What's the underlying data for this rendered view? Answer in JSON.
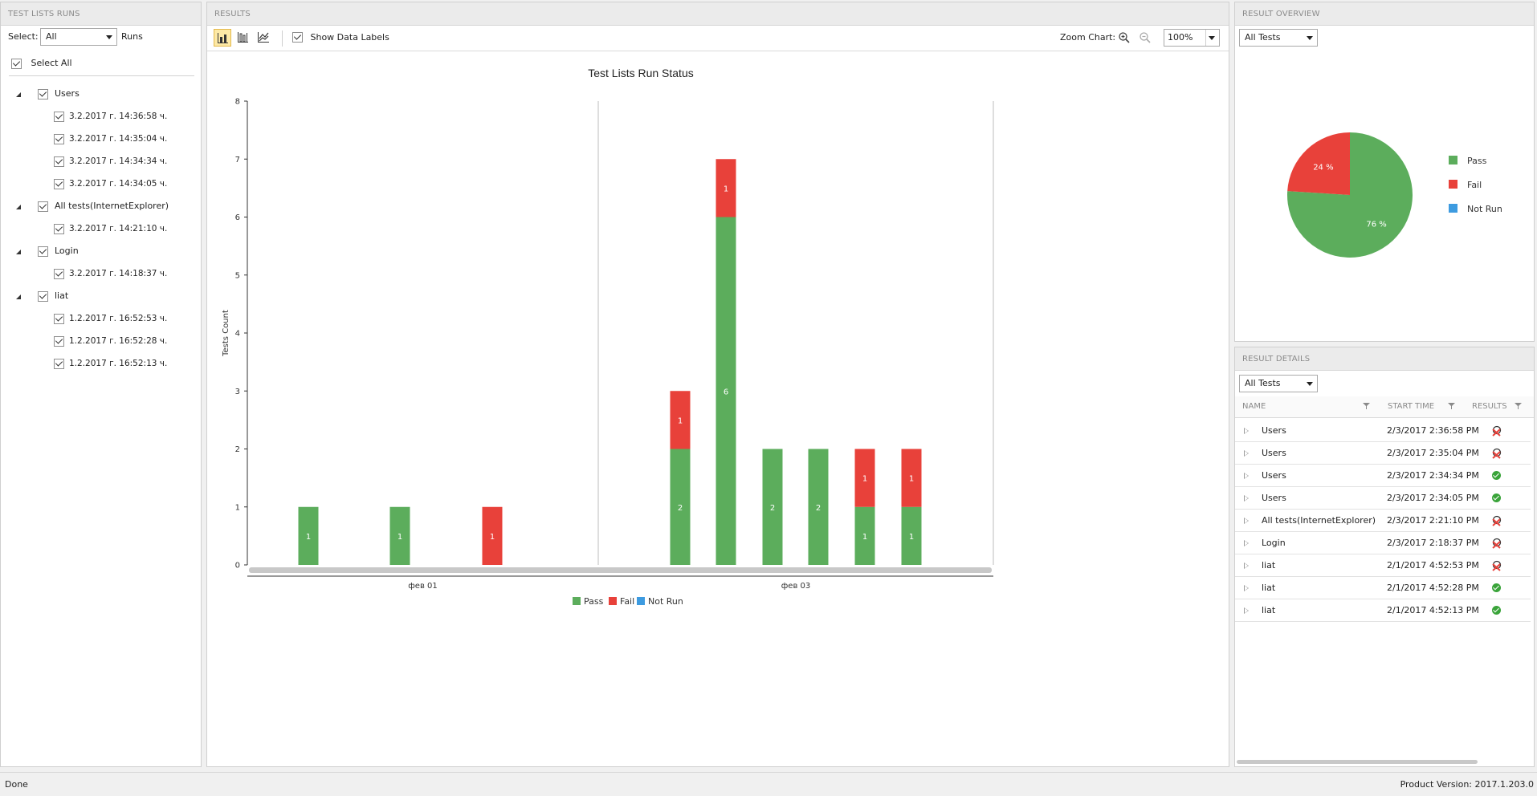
{
  "test_lists_runs": {
    "header": "TEST LISTS RUNS",
    "select_label": "Select:",
    "select_value": "All",
    "runs_label": "Runs",
    "select_all_label": "Select All",
    "groups": [
      {
        "name": "Users",
        "runs": [
          "3.2.2017 г. 14:36:58 ч.",
          "3.2.2017 г. 14:35:04 ч.",
          "3.2.2017 г. 14:34:34 ч.",
          "3.2.2017 г. 14:34:05 ч."
        ]
      },
      {
        "name": "All tests(InternetExplorer)",
        "runs": [
          "3.2.2017 г. 14:21:10 ч."
        ]
      },
      {
        "name": "Login",
        "runs": [
          "3.2.2017 г. 14:18:37 ч."
        ]
      },
      {
        "name": "liat",
        "runs": [
          "1.2.2017 г. 16:52:53 ч.",
          "1.2.2017 г. 16:52:28 ч.",
          "1.2.2017 г. 16:52:13 ч."
        ]
      }
    ]
  },
  "results": {
    "header": "RESULTS",
    "show_data_labels": "Show Data Labels",
    "zoom_label": "Zoom Chart:",
    "zoom_value": "100%"
  },
  "chart_data": {
    "type": "bar",
    "stacked": true,
    "title": "Test Lists Run Status",
    "ylabel": "Tests Count",
    "xlabel": "",
    "ylim": [
      0,
      8
    ],
    "yticks": [
      0,
      1,
      2,
      3,
      4,
      5,
      6,
      7,
      8
    ],
    "x_groups": [
      "фев 01",
      "фев 03"
    ],
    "bars": [
      {
        "group": 0,
        "pass": 1,
        "fail": 0,
        "not_run": 0
      },
      {
        "group": 0,
        "pass": 1,
        "fail": 0,
        "not_run": 0
      },
      {
        "group": 0,
        "pass": 0,
        "fail": 1,
        "not_run": 0
      },
      {
        "group": 1,
        "pass": 2,
        "fail": 1,
        "not_run": 0
      },
      {
        "group": 1,
        "pass": 6,
        "fail": 1,
        "not_run": 0
      },
      {
        "group": 1,
        "pass": 2,
        "fail": 0,
        "not_run": 0
      },
      {
        "group": 1,
        "pass": 2,
        "fail": 0,
        "not_run": 0
      },
      {
        "group": 1,
        "pass": 1,
        "fail": 1,
        "not_run": 0
      },
      {
        "group": 1,
        "pass": 1,
        "fail": 1,
        "not_run": 0
      }
    ],
    "legend": [
      "Pass",
      "Fail",
      "Not Run"
    ],
    "legend_position": "bottom",
    "colors": {
      "pass": "#5cad5c",
      "fail": "#e8413a",
      "not_run": "#3d9be0"
    }
  },
  "result_overview": {
    "header": "RESULT OVERVIEW",
    "filter_value": "All Tests",
    "pie": {
      "type": "pie",
      "slices": [
        {
          "label": "Pass",
          "value": 76,
          "text": "76 %",
          "color": "#5cad5c"
        },
        {
          "label": "Fail",
          "value": 24,
          "text": "24 %",
          "color": "#e8413a"
        },
        {
          "label": "Not Run",
          "value": 0,
          "text": "",
          "color": "#3d9be0"
        }
      ],
      "legend_position": "right"
    }
  },
  "result_details": {
    "header": "RESULT DETAILS",
    "filter_value": "All Tests",
    "columns": [
      "NAME",
      "START TIME",
      "RESULTS"
    ],
    "rows": [
      {
        "name": "Users",
        "start": "2/3/2017 2:36:58 PM",
        "result": "fail"
      },
      {
        "name": "Users",
        "start": "2/3/2017 2:35:04 PM",
        "result": "fail"
      },
      {
        "name": "Users",
        "start": "2/3/2017 2:34:34 PM",
        "result": "pass"
      },
      {
        "name": "Users",
        "start": "2/3/2017 2:34:05 PM",
        "result": "pass"
      },
      {
        "name": "All tests(InternetExplorer)",
        "start": "2/3/2017 2:21:10 PM",
        "result": "fail"
      },
      {
        "name": "Login",
        "start": "2/3/2017 2:18:37 PM",
        "result": "fail"
      },
      {
        "name": "liat",
        "start": "2/1/2017 4:52:53 PM",
        "result": "fail"
      },
      {
        "name": "liat",
        "start": "2/1/2017 4:52:28 PM",
        "result": "pass"
      },
      {
        "name": "liat",
        "start": "2/1/2017 4:52:13 PM",
        "result": "pass"
      }
    ]
  },
  "status": {
    "left": "Done",
    "right": "Product Version: 2017.1.203.0"
  }
}
